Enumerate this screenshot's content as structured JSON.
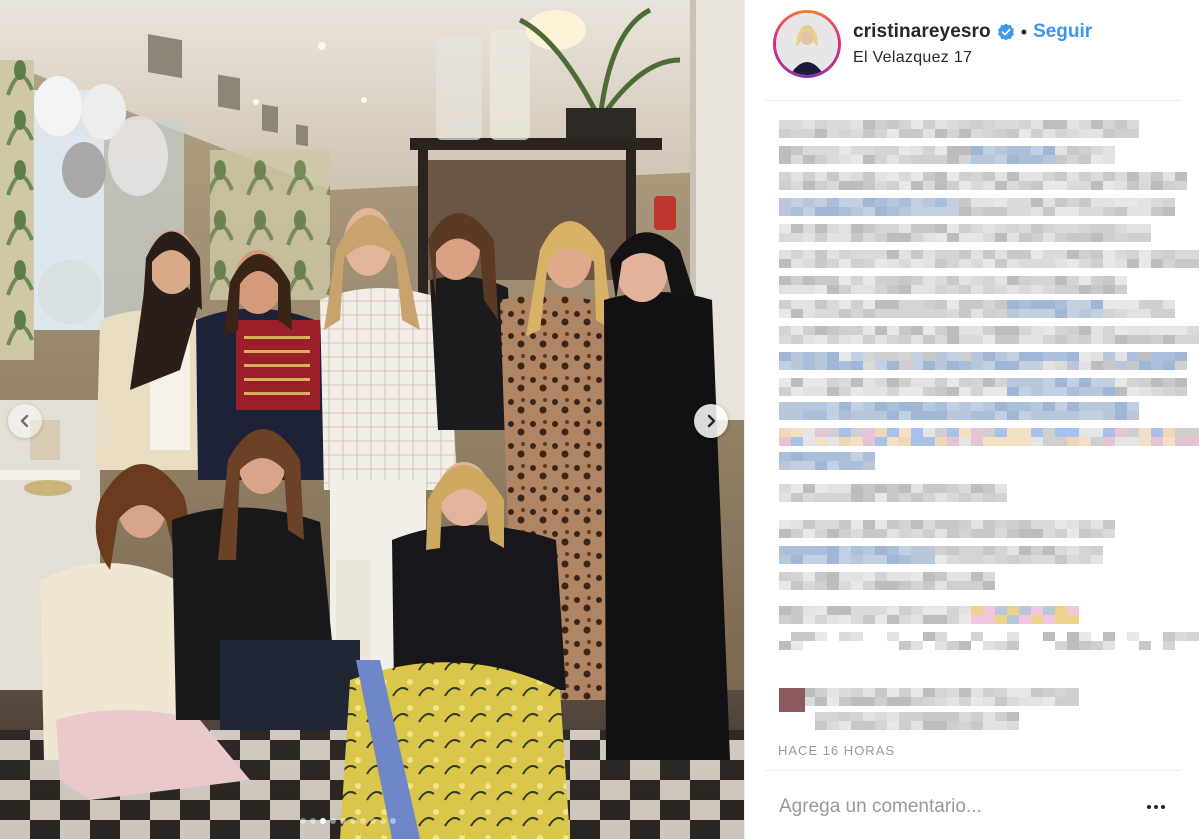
{
  "header": {
    "username": "cristinareyesro",
    "separator": "•",
    "follow_label": "Seguir",
    "location": "El Velazquez 17",
    "verified": true
  },
  "icons": {
    "verified": "verified-badge-icon",
    "prev": "chevron-left-icon",
    "next": "chevron-right-icon",
    "more": "more-options-icon"
  },
  "carousel": {
    "total_slides": 10,
    "active_slide": 3
  },
  "caption": {
    "blurred": true
  },
  "timestamp": "HACE 16 HORAS",
  "comment": {
    "placeholder": "Agrega un comentario..."
  },
  "colors": {
    "link_blue": "#3897f0",
    "text": "#262626",
    "muted": "#999999"
  }
}
